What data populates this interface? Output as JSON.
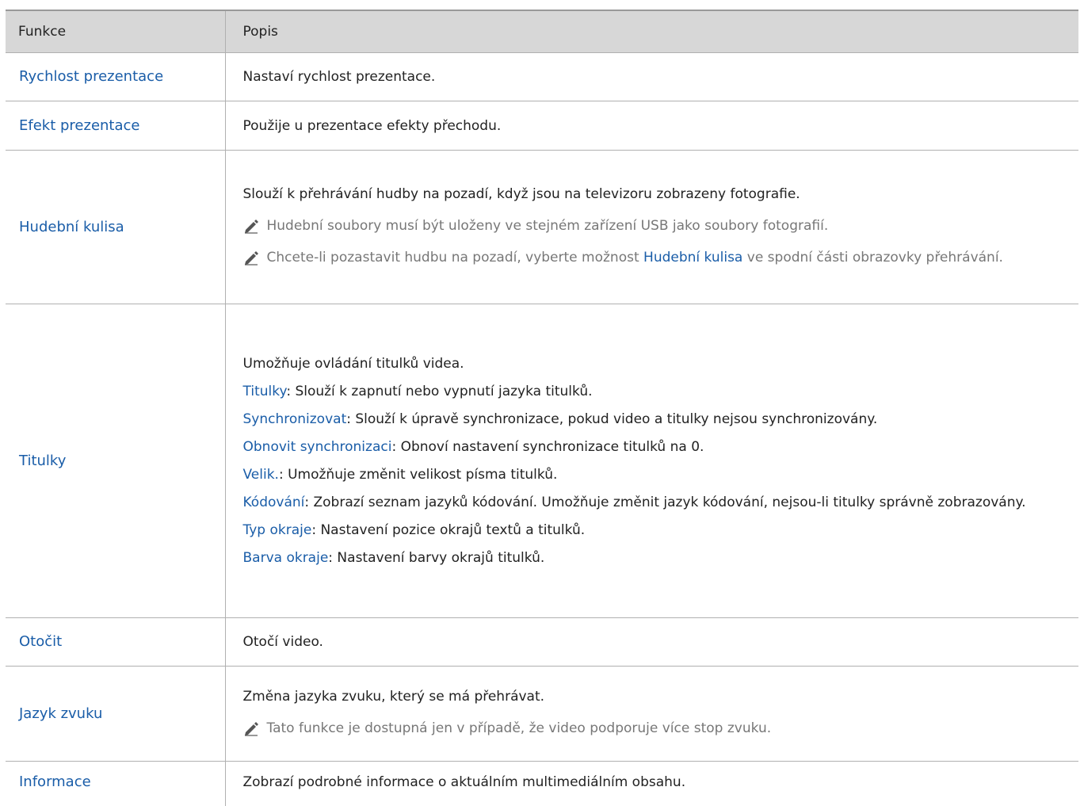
{
  "header": {
    "col1": "Funkce",
    "col2": "Popis"
  },
  "rows": {
    "rychlost": {
      "name": "Rychlost prezentace",
      "desc": "Nastaví rychlost prezentace."
    },
    "efekt": {
      "name": "Efekt prezentace",
      "desc": "Použije u prezentace efekty přechodu."
    },
    "hudba": {
      "name": "Hudební kulisa",
      "desc": "Slouží k přehrávání hudby na pozadí, když jsou na televizoru zobrazeny fotografie.",
      "note1": "Hudební soubory musí být uloženy ve stejném zařízení USB jako soubory fotografií.",
      "note2_pre": "Chcete-li pozastavit hudbu na pozadí, vyberte možnost ",
      "note2_hl": "Hudební kulisa",
      "note2_post": " ve spodní části obrazovky přehrávání."
    },
    "titulky": {
      "name": "Titulky",
      "intro": "Umožňuje ovládání titulků videa.",
      "items": [
        {
          "term": "Titulky",
          "text": ": Slouží k zapnutí nebo vypnutí jazyka titulků."
        },
        {
          "term": "Synchronizovat",
          "text": ": Slouží k úpravě synchronizace, pokud video a titulky nejsou synchronizovány."
        },
        {
          "term": "Obnovit synchronizaci",
          "text": ": Obnoví nastavení synchronizace titulků na 0."
        },
        {
          "term": "Velik.",
          "text": ": Umožňuje změnit velikost písma titulků."
        },
        {
          "term": "Kódování",
          "text": ": Zobrazí seznam jazyků kódování. Umožňuje změnit jazyk kódování, nejsou-li titulky správně zobrazovány."
        },
        {
          "term": "Typ okraje",
          "text": ": Nastavení pozice okrajů textů a titulků."
        },
        {
          "term": "Barva okraje",
          "text": ": Nastavení barvy okrajů titulků."
        }
      ]
    },
    "otocit": {
      "name": "Otočit",
      "desc": "Otočí video."
    },
    "jazyk": {
      "name": "Jazyk zvuku",
      "desc": "Změna jazyka zvuku, který se má přehrávat.",
      "note1": "Tato funkce je dostupná jen v případě, že video podporuje více stop zvuku."
    },
    "informace": {
      "name": "Informace",
      "desc": "Zobrazí podrobné informace o aktuálním multimediálním obsahu."
    }
  },
  "icons": {
    "note": "pencil-icon"
  },
  "colors": {
    "link": "#1a5da8",
    "header_bg": "#d7d7d7",
    "note_text": "#777777"
  }
}
